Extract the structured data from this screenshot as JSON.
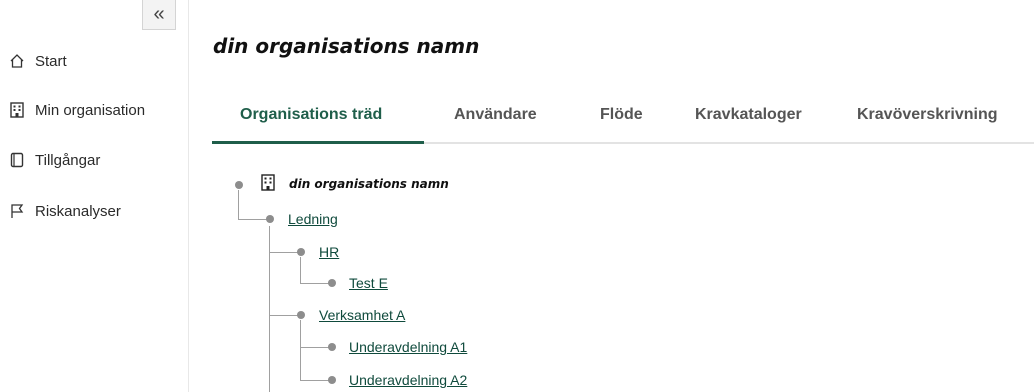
{
  "sidebar": {
    "collapse_icon": "double-chevron-left-icon",
    "collapse_glyph": "«",
    "items": [
      {
        "label": "Start",
        "icon": "home-icon"
      },
      {
        "label": "Min organisation",
        "icon": "building-icon"
      },
      {
        "label": "Tillgångar",
        "icon": "document-icon"
      },
      {
        "label": "Riskanalyser",
        "icon": "flag-icon"
      }
    ]
  },
  "page": {
    "title": "din organisations namn"
  },
  "tabs": [
    {
      "label": "Organisations träd",
      "active": true
    },
    {
      "label": "Användare",
      "active": false
    },
    {
      "label": "Flöde",
      "active": false
    },
    {
      "label": "Kravkataloger",
      "active": false
    },
    {
      "label": "Kravöverskrivning",
      "active": false
    }
  ],
  "tree": {
    "root": {
      "label": "din organisations namn",
      "icon": "building-icon"
    },
    "nodes": [
      {
        "label": "Ledning"
      },
      {
        "label": "HR"
      },
      {
        "label": "Test E"
      },
      {
        "label": "Verksamhet A"
      },
      {
        "label": "Underavdelning A1"
      },
      {
        "label": "Underavdelning A2"
      }
    ]
  },
  "colors": {
    "accent": "#1f5e4a",
    "link": "#0f4a3c",
    "tree_line": "#a0a0a0"
  }
}
